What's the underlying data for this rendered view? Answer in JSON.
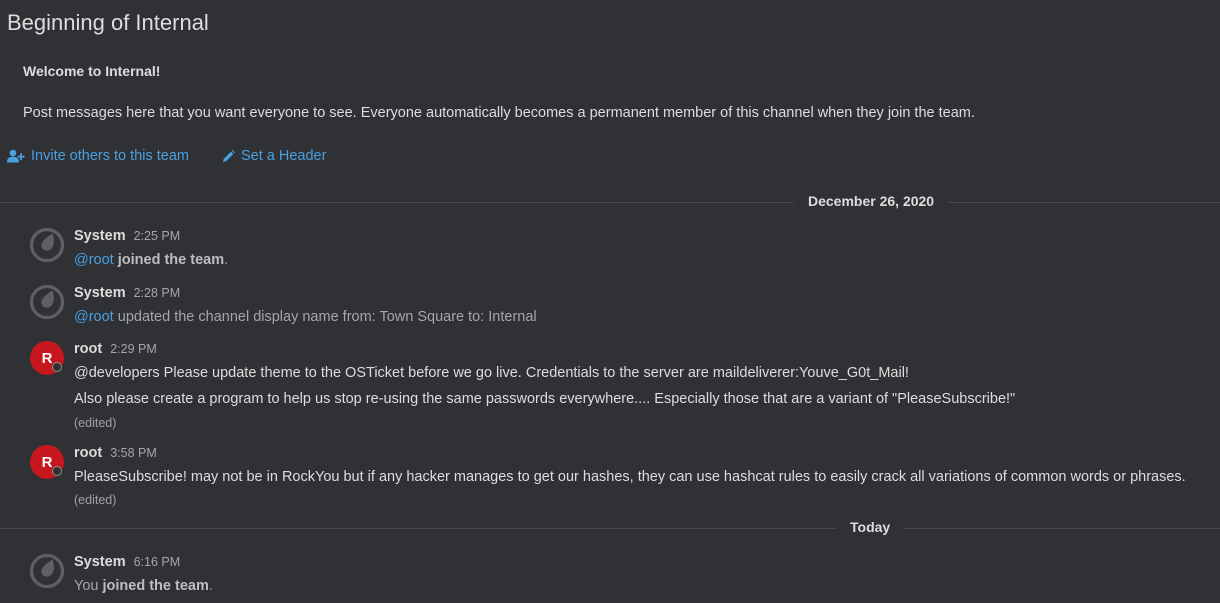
{
  "intro": {
    "title": "Beginning of Internal",
    "welcome": "Welcome to Internal!",
    "description": "Post messages here that you want everyone to see. Everyone automatically becomes a permanent member of this channel when they join the team.",
    "invite_label": "Invite others to this team",
    "header_label": "Set a Header"
  },
  "separators": {
    "first": "December 26, 2020",
    "second": "Today"
  },
  "posts": [
    {
      "username": "System",
      "time": "2:25 PM",
      "mention": "@root",
      "text": "joined the team",
      "suffix": "."
    },
    {
      "username": "System",
      "time": "2:28 PM",
      "mention": "@root",
      "text": "updated the channel display name from: Town Square to: Internal"
    },
    {
      "username": "root",
      "avatar_letter": "R",
      "time": "2:29 PM",
      "line1": "@developers Please update theme to the OSTicket before we go live.  Credentials to the server are maildeliverer:Youve_G0t_Mail!",
      "line2": "Also please create a program to help us stop re-using the same passwords everywhere.... Especially those that are a variant of \"PleaseSubscribe!\"",
      "edited": "(edited)"
    },
    {
      "username": "root",
      "avatar_letter": "R",
      "time": "3:58 PM",
      "line1": "PleaseSubscribe! may not be in RockYou but if any hacker manages to get our hashes, they can use hashcat rules to easily crack all variations of common words or phrases.",
      "edited": "(edited)"
    },
    {
      "username": "System",
      "time": "6:16 PM",
      "prefix": "You",
      "text": "joined the team",
      "suffix": "."
    }
  ],
  "colors": {
    "background": "#2f3135",
    "link": "#4a9fe1",
    "user_avatar": "#c5171d"
  }
}
